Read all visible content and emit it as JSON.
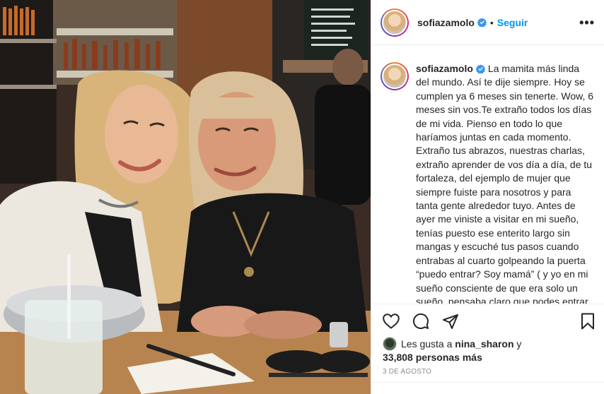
{
  "post": {
    "username": "sofiazamolo",
    "follow_label": "Seguir",
    "more_label": "•••",
    "caption": "La mamita más linda del mundo. Así te dije siempre. Hoy se cumplen ya 6 meses sin tenerte. Wow, 6 meses sin vos.Te extraño todos los días de mi vida. Pienso en todo lo que haríamos juntas en cada momento. Extraño tus abrazos, nuestras charlas, extraño aprender de vos día a día, de tu fortaleza, del ejemplo de mujer que siempre fuiste para nosotros y para tanta gente alrededor tuyo. Antes de ayer me viniste a visitar en mi sueño, tenías puesto ese enterito largo sin mangas y escuché tus pasos cuando entrabas al cuarto golpeando la puerta “puedo entrar? Soy mamá” ( y yo en mi sueño consciente de que era solo un sueño, pensaba claro que podes entrar reina de mi alma, entra y"
  },
  "likes": {
    "prefix": "Les gusta a",
    "liker": "nina_sharon",
    "connector": "y",
    "count": "33,808 personas más"
  },
  "date": "3 DE AGOSTO",
  "icons": {
    "like": "heart-icon",
    "comment": "comment-icon",
    "share": "share-icon",
    "save": "bookmark-icon",
    "verified": "verified-badge-icon"
  },
  "colors": {
    "follow": "#0095f6",
    "verified": "#3897f0",
    "muted": "#8e8e8e",
    "text": "#262626"
  }
}
